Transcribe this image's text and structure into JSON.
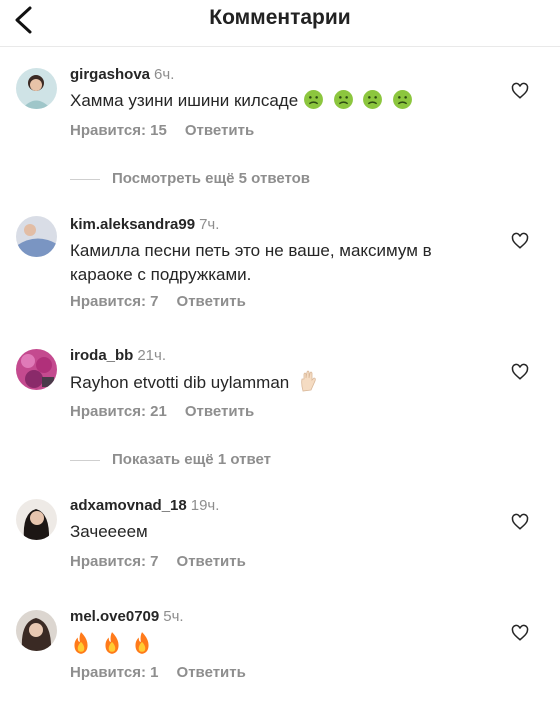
{
  "header": {
    "title": "Комментарии"
  },
  "comments": [
    {
      "username": "girgashova",
      "time": "6ч.",
      "text": "Хамма узини ишини килсаде",
      "likes": "Нравится: 15",
      "reply": "Ответить"
    },
    {
      "username": "kim.aleksandra99",
      "time": "7ч.",
      "text": "Камилла песни петь это не ваше, максимум в караоке с подружками.",
      "likes": "Нравится: 7",
      "reply": "Ответить"
    },
    {
      "username": "iroda_bb",
      "time": "21ч.",
      "text": "Rayhon etvotti dib uylamman",
      "likes": "Нравится: 21",
      "reply": "Ответить"
    },
    {
      "username": "adxamovnad_18",
      "time": "19ч.",
      "text": "Зачеееем",
      "likes": "Нравится: 7",
      "reply": "Ответить"
    },
    {
      "username": "mel.ove0709",
      "time": "5ч.",
      "text": "",
      "likes": "Нравится: 1",
      "reply": "Ответить"
    }
  ],
  "view_replies": [
    {
      "label": "Посмотреть ещё 5 ответов"
    },
    {
      "label": "Показать ещё 1 ответ"
    }
  ],
  "icons": {
    "back": "chevron-left-icon",
    "like": "heart-outline-icon",
    "emoji_1": "nauseated-face-emoji",
    "emoji_3": "hand-emoji",
    "emoji_5": "fire-emoji"
  },
  "colors": {
    "text": "#262626",
    "secondary": "#8e8e8e",
    "emoji_green": "#8cc63e",
    "fire": "#ff7a1a"
  }
}
